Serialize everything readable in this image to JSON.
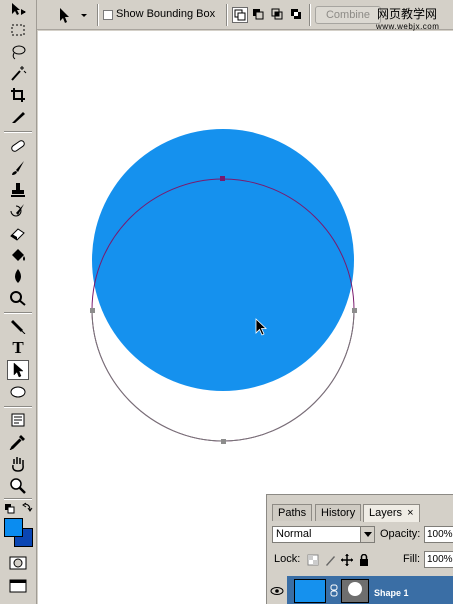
{
  "options_bar": {
    "tool_preset_icon": "path-selection-arrow-icon",
    "show_bounding_box": {
      "label": "Show Bounding Box",
      "checked": false
    },
    "shape_modes": [
      "add-to-shape-icon",
      "subtract-from-shape-icon",
      "intersect-shape-icon",
      "exclude-overlap-icon"
    ],
    "combine_label": "Combine",
    "watermark_text": "网页教学网",
    "watermark_url": "www.webjx.com"
  },
  "toolbox": {
    "tools": [
      "move-tool-icon",
      "marquee-tool-icon",
      "lasso-tool-icon",
      "magic-wand-tool-icon",
      "crop-tool-icon",
      "slice-tool-icon",
      "healing-brush-tool-icon",
      "brush-tool-icon",
      "clone-stamp-tool-icon",
      "history-brush-tool-icon",
      "eraser-tool-icon",
      "paint-bucket-tool-icon",
      "blur-tool-icon",
      "dodge-tool-icon",
      "pen-tool-icon",
      "type-tool-icon",
      "direct-selection-tool-icon",
      "ellipse-tool-icon",
      "notes-tool-icon",
      "eyedropper-tool-icon",
      "hand-tool-icon",
      "zoom-tool-icon"
    ],
    "active_tool": "direct-selection-tool-icon",
    "foreground_color": "#0a8cf0",
    "background_color": "#0a46b4",
    "type_tool_glyph": "T"
  },
  "canvas": {
    "background": "#ffffff",
    "shape_fill": "#1591ee",
    "path_color": "#7a1a6e"
  },
  "layers_panel": {
    "tabs": [
      {
        "label": "Paths",
        "active": false
      },
      {
        "label": "History",
        "active": false
      },
      {
        "label": "Layers",
        "active": true
      }
    ],
    "close_glyph": "×",
    "blend_mode": "Normal",
    "opacity_label": "Opacity:",
    "opacity_value": "100%",
    "lock_label": "Lock:",
    "fill_label": "Fill:",
    "fill_value": "100%",
    "layer": {
      "name": "Shape 1",
      "visible": true
    }
  }
}
